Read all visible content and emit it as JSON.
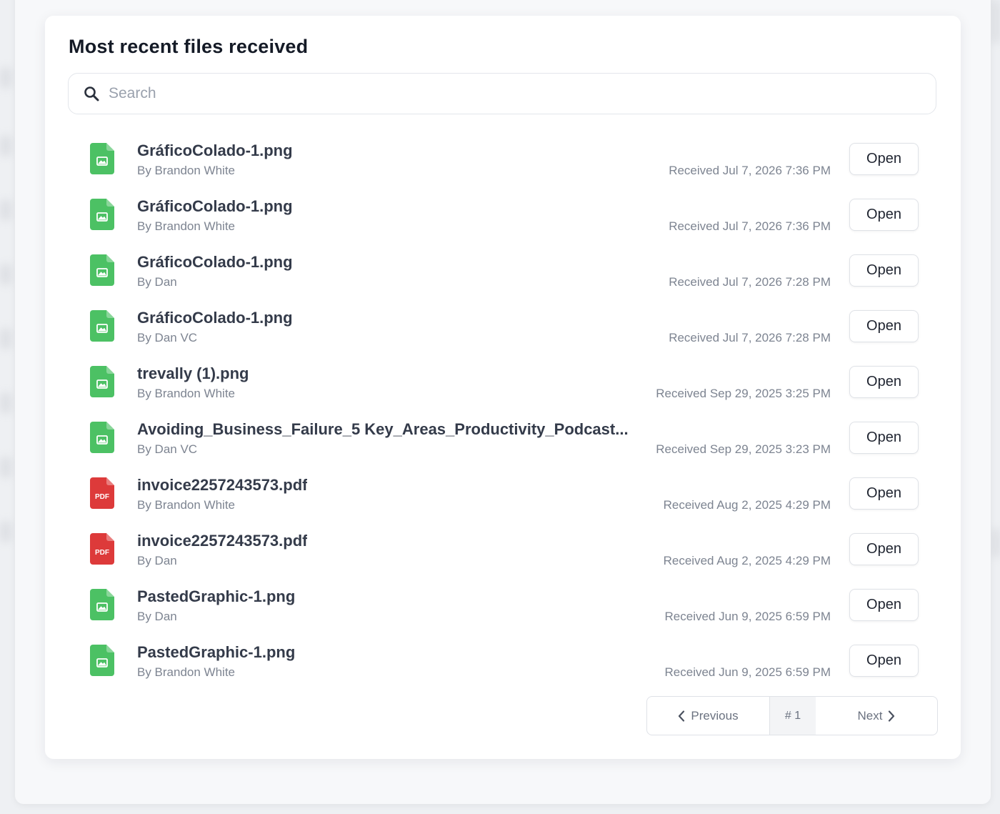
{
  "card": {
    "title": "Most recent files received"
  },
  "search": {
    "placeholder": "Search",
    "value": ""
  },
  "files": [
    {
      "name": "GráficoColado-1.png",
      "by": "By Brandon White",
      "received": "Received Jul 7, 2026 7:36 PM",
      "type": "image",
      "action": "Open"
    },
    {
      "name": "GráficoColado-1.png",
      "by": "By Brandon White",
      "received": "Received Jul 7, 2026 7:36 PM",
      "type": "image",
      "action": "Open"
    },
    {
      "name": "GráficoColado-1.png",
      "by": "By Dan",
      "received": "Received Jul 7, 2026 7:28 PM",
      "type": "image",
      "action": "Open"
    },
    {
      "name": "GráficoColado-1.png",
      "by": "By Dan VC",
      "received": "Received Jul 7, 2026 7:28 PM",
      "type": "image",
      "action": "Open"
    },
    {
      "name": "trevally (1).png",
      "by": "By Brandon White",
      "received": "Received Sep 29, 2025 3:25 PM",
      "type": "image",
      "action": "Open"
    },
    {
      "name": "Avoiding_Business_Failure_5 Key_Areas_Productivity_Podcast...",
      "by": "By Dan VC",
      "received": "Received Sep 29, 2025 3:23 PM",
      "type": "image",
      "action": "Open"
    },
    {
      "name": "invoice2257243573.pdf",
      "by": "By Brandon White",
      "received": "Received Aug 2, 2025 4:29 PM",
      "type": "pdf",
      "action": "Open"
    },
    {
      "name": "invoice2257243573.pdf",
      "by": "By Dan",
      "received": "Received Aug 2, 2025 4:29 PM",
      "type": "pdf",
      "action": "Open"
    },
    {
      "name": "PastedGraphic-1.png",
      "by": "By Dan",
      "received": "Received Jun 9, 2025 6:59 PM",
      "type": "image",
      "action": "Open"
    },
    {
      "name": "PastedGraphic-1.png",
      "by": "By Brandon White",
      "received": "Received Jun 9, 2025 6:59 PM",
      "type": "image",
      "action": "Open"
    }
  ],
  "icons": {
    "image": {
      "name": "image-file-icon",
      "color": "#4cc164"
    },
    "pdf": {
      "name": "pdf-file-icon",
      "color": "#dd3a3a",
      "label": "PDF"
    }
  },
  "pagination": {
    "previous_label": "Previous",
    "current_label": "# 1",
    "next_label": "Next"
  }
}
